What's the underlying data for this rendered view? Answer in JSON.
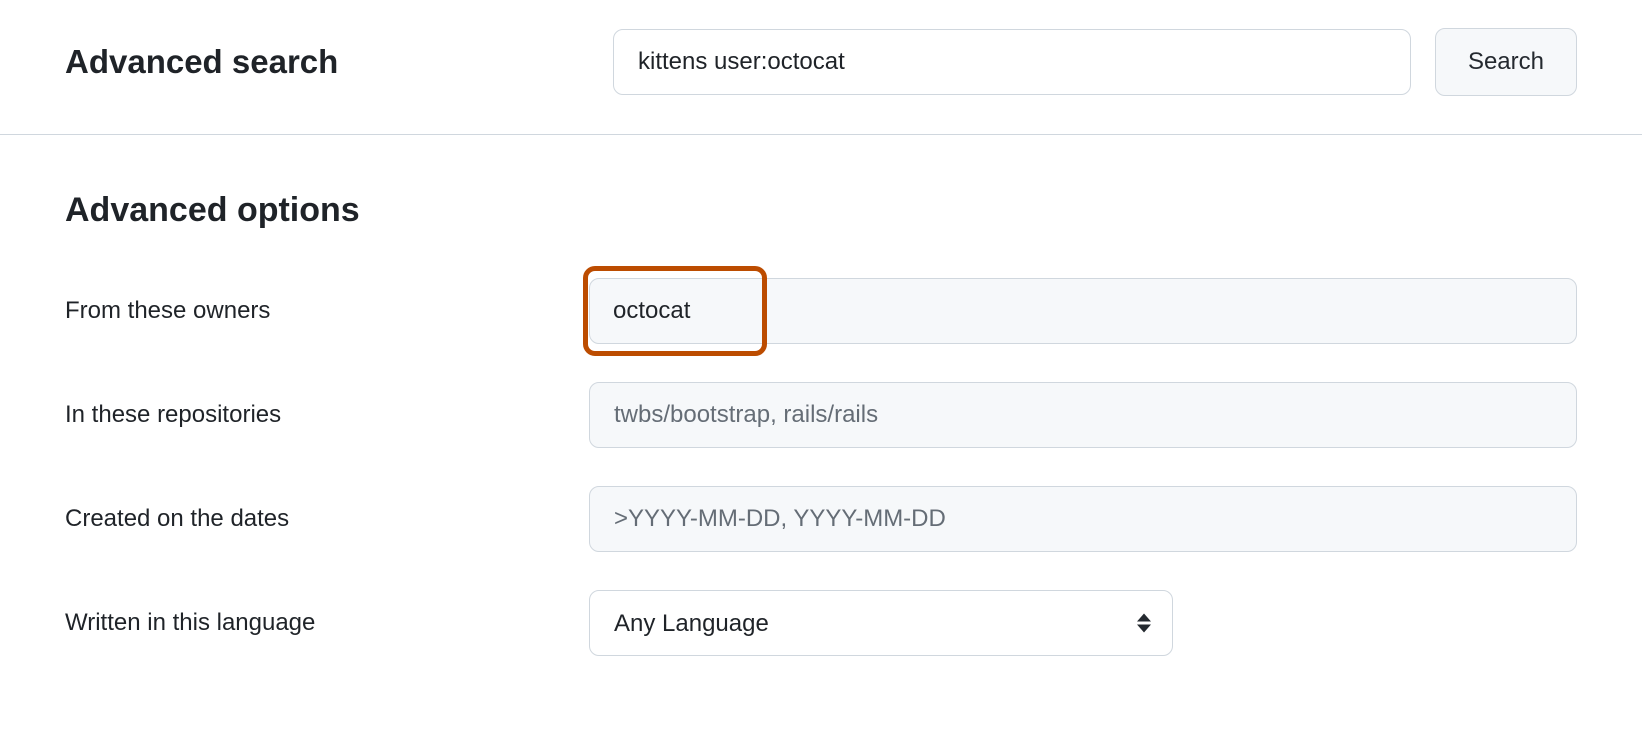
{
  "header": {
    "title": "Advanced search",
    "search_value": "kittens user:octocat",
    "search_button_label": "Search"
  },
  "options": {
    "section_title": "Advanced options",
    "rows": {
      "owners": {
        "label": "From these owners",
        "value": "octocat",
        "placeholder": ""
      },
      "repositories": {
        "label": "In these repositories",
        "value": "",
        "placeholder": "twbs/bootstrap, rails/rails"
      },
      "dates": {
        "label": "Created on the dates",
        "value": "",
        "placeholder": ">YYYY-MM-DD, YYYY-MM-DD"
      },
      "language": {
        "label": "Written in this language",
        "selected": "Any Language"
      }
    }
  }
}
